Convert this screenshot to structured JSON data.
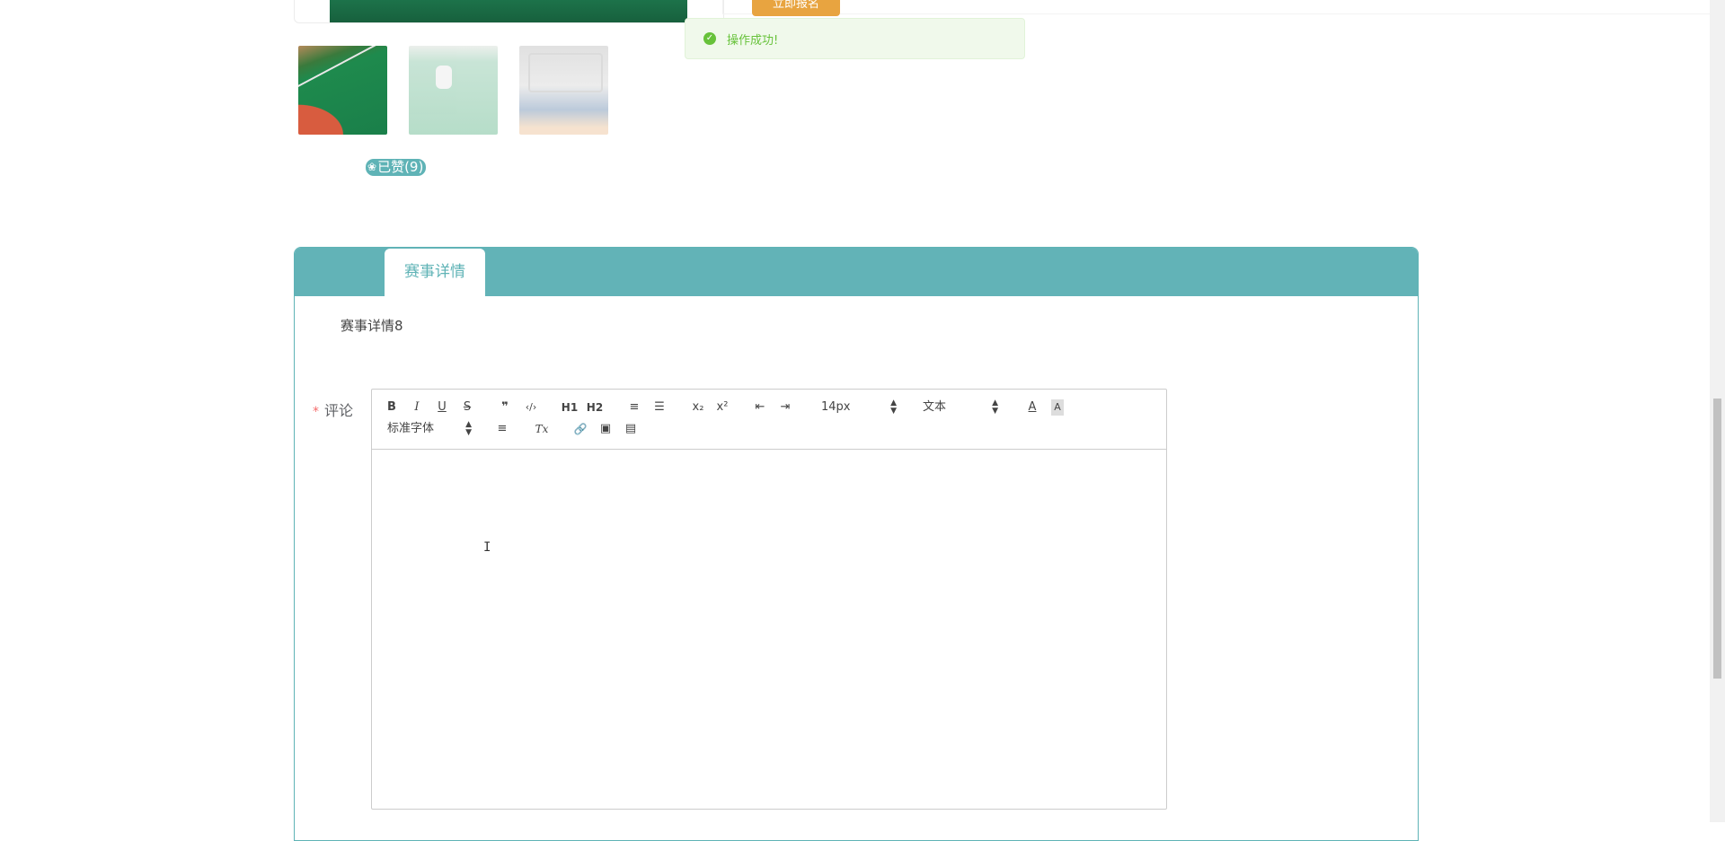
{
  "top": {
    "signup_label": "立即报名"
  },
  "likes": {
    "label": "已赞(9)"
  },
  "toast": {
    "message": "操作成功!"
  },
  "panel": {
    "tab_label": "赛事详情",
    "detail_text": "赛事详情8"
  },
  "comment": {
    "required_mark": "*",
    "label": "评论"
  },
  "editor": {
    "font_size": "14px",
    "header_select": "文本",
    "font_family": "标准字体",
    "buttons": {
      "bold": "B",
      "italic": "I",
      "underline": "U",
      "strike": "S",
      "quote": "❞",
      "code": "‹/›",
      "h1": "H1",
      "h2": "H2",
      "ordered_list": "≡",
      "bullet_list": "☰",
      "subscript": "x₂",
      "superscript": "x²",
      "outdent": "⇤",
      "indent": "⇥",
      "color": "A",
      "background": "A",
      "align": "≡",
      "clean": "Tx",
      "link": "🔗",
      "image": "▣",
      "video": "▤"
    }
  },
  "colors": {
    "accent": "#5fb3b6",
    "success": "#67c23a",
    "orange": "#e8a440"
  }
}
